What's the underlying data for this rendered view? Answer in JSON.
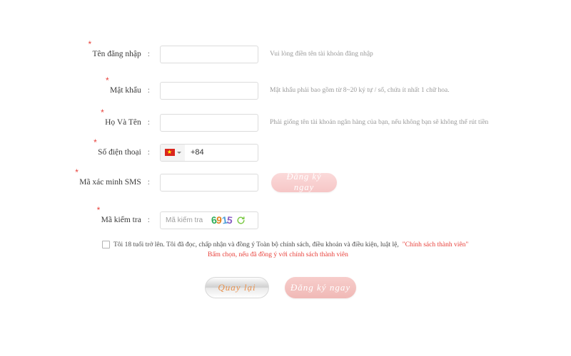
{
  "form": {
    "rows": [
      {
        "label": "Tên đăng nhập",
        "required": true,
        "colon": ":",
        "value": "",
        "placeholder": "",
        "hint": "Vui lòng điền tên tài khoản đăng nhập"
      },
      {
        "label": "Mật khẩu",
        "required": true,
        "colon": ":",
        "value": "",
        "placeholder": "",
        "hint": "Mật khẩu phải bao gồm từ 8~20 ký tự / số, chứa ít nhất 1 chữ hoa."
      },
      {
        "label": "Họ Và Tên",
        "required": true,
        "colon": ":",
        "value": "",
        "placeholder": "",
        "hint": "Phải giống tên tài khoản ngân hàng của bạn, nếu không bạn sẽ không thể rút tiền"
      },
      {
        "label": "Số điện thoại",
        "required": true,
        "colon": ":",
        "dial_code": "+84",
        "country_flag": "vietnam-flag",
        "value": "",
        "placeholder": "",
        "hint": ""
      },
      {
        "label": "Mã xác minh SMS",
        "required": true,
        "colon": ":",
        "value": "",
        "placeholder": "",
        "hint": "",
        "action_button": "Đăng ký ngay"
      },
      {
        "label": "Mã kiểm tra",
        "required": true,
        "colon": ":",
        "value": "",
        "placeholder": "Mã kiểm tra",
        "captcha_code": "6915",
        "refresh_icon": "refresh-icon",
        "hint": ""
      }
    ]
  },
  "terms": {
    "checkbox_checked": false,
    "text": "Tôi 18 tuổi trở lên. Tôi đã đọc, chấp nhận và đồng ý Toàn bộ chính sách, điều khoản và điều kiện, luật lệ,",
    "policy_link": "\"Chính sách thành viên\"",
    "warning": "Bấm chọn, nếu đã đồng ý với chính sách thành viên"
  },
  "buttons": {
    "back": "Quay lại",
    "submit": "Đăng ký ngay"
  },
  "colors": {
    "required_star": "#e8403a",
    "link_red": "#e8413b",
    "pink_button": "#f0b9b6",
    "back_button_text": "#e8924f",
    "captcha_green": "#2fae5a",
    "refresh_green": "#7ac943"
  }
}
